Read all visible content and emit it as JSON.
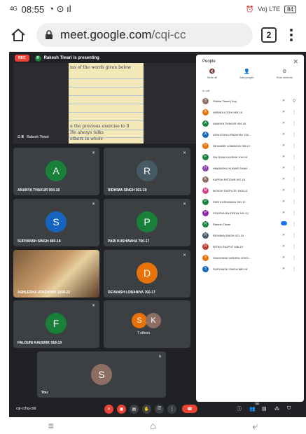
{
  "status": {
    "time": "08:55",
    "signal": "4G",
    "lte": "Vo) LTE",
    "battery": "84"
  },
  "browser": {
    "url_host": "meet.google.com",
    "url_path": "/cqi-cc",
    "tab_count": "2"
  },
  "meet": {
    "rec_label": "REC",
    "presenting_initial": "R",
    "presenting_text": "Rakesh Tiwari is presenting",
    "presenter_name": "Rakesh Tiwari",
    "paper_lines": [
      "ms of the words given below",
      "n the previous exercise to fi",
      "He always talks",
      "others in"
    ],
    "paper_handwriting": "whole",
    "tiles": [
      {
        "initial": "A",
        "name": "ANANYA THAKUR 904-18",
        "color": "#188038"
      },
      {
        "initial": "R",
        "name": "RIDHIMA SINGH 921-19",
        "color": "#455a64"
      },
      {
        "initial": "S",
        "name": "SURYANSH SINGH 880-18",
        "color": "#1565c0"
      },
      {
        "initial": "P",
        "name": "PARI KUSHWAHA 760-17",
        "color": "#188038"
      },
      {
        "name": "ASHLESHA UPADHYAY 1008-21"
      },
      {
        "initial": "D",
        "name": "DEVANSH LOBANIYA 760-17",
        "color": "#e8710a"
      },
      {
        "initial": "F",
        "name": "FALOUNI KAUSHIK 918-19",
        "color": "#188038"
      },
      {
        "name": "You",
        "initial": "S",
        "color": "#8d6e63"
      }
    ],
    "others": {
      "initials": [
        "S",
        "K"
      ],
      "colors": [
        "#e8710a",
        "#8d6e63"
      ],
      "label": "7 others"
    },
    "meeting_code": "cqi-cchq-cdd",
    "participant_badge": "16"
  },
  "people": {
    "title": "People",
    "close": "✕",
    "controls": [
      {
        "icon": "mute-all-icon",
        "label": "Mute all",
        "glyph": "🔇"
      },
      {
        "icon": "add-people-icon",
        "label": "Add people",
        "glyph": "👤"
      },
      {
        "icon": "host-controls-icon",
        "label": "Host controls",
        "glyph": "⚙"
      }
    ],
    "section": "In call",
    "list": [
      {
        "initial": "S",
        "name": "Shikha Tiwari (You)",
        "color": "#8d6e63",
        "state": "pin"
      },
      {
        "initial": "A",
        "name": "AMBIKA LODHI 665-16",
        "color": "#e8710a",
        "state": "muted"
      },
      {
        "initial": "A",
        "name": "ANANYA THAKUR 904-18",
        "color": "#188038",
        "state": "muted"
      },
      {
        "initial": "A",
        "name": "ASHLESHA UPADHYAY 100...",
        "color": "#1565c0",
        "state": "muted"
      },
      {
        "initial": "D",
        "name": "DEVANSH LOBANIYA 768-17",
        "color": "#e8710a",
        "state": "muted"
      },
      {
        "initial": "F",
        "name": "FALOUNI KAUSHIK 918-19",
        "color": "#188038",
        "state": "muted"
      },
      {
        "initial": "H",
        "name": "HIMANSHU KUMAR SHAH ...",
        "color": "#8e44ad",
        "state": "muted"
      },
      {
        "initial": "K",
        "name": "KAPISH PATIDAR 697-16",
        "color": "#8d6e63",
        "state": "muted"
      },
      {
        "initial": "M",
        "name": "MOKSH SATPUTE 1003-21",
        "color": "#d63f8c",
        "state": "muted"
      },
      {
        "initial": "P",
        "name": "PARI KUSHWAHA 760-17",
        "color": "#188038",
        "state": "muted"
      },
      {
        "initial": "P",
        "name": "POORVA RAJORIYA 342-12",
        "color": "#8e24aa",
        "state": "muted"
      },
      {
        "initial": "R",
        "name": "Rakesh Tiwari",
        "color": "#188038",
        "state": "speaking"
      },
      {
        "initial": "R",
        "name": "RIDHIMA SINGH 921-19",
        "color": "#455a64",
        "state": "muted"
      },
      {
        "initial": "R",
        "name": "RITIKA RAJPUT 936-19",
        "color": "#c0392b",
        "state": "muted"
      },
      {
        "initial": "S",
        "name": "SHASHANK MISHRA JOHO...",
        "color": "#e8710a",
        "state": "muted"
      },
      {
        "initial": "S",
        "name": "SURYANSH SINGH 880-18",
        "color": "#1565c0",
        "state": "muted"
      }
    ]
  },
  "nav": {
    "menu": "≡",
    "home": "⌂",
    "back": "⤶"
  }
}
